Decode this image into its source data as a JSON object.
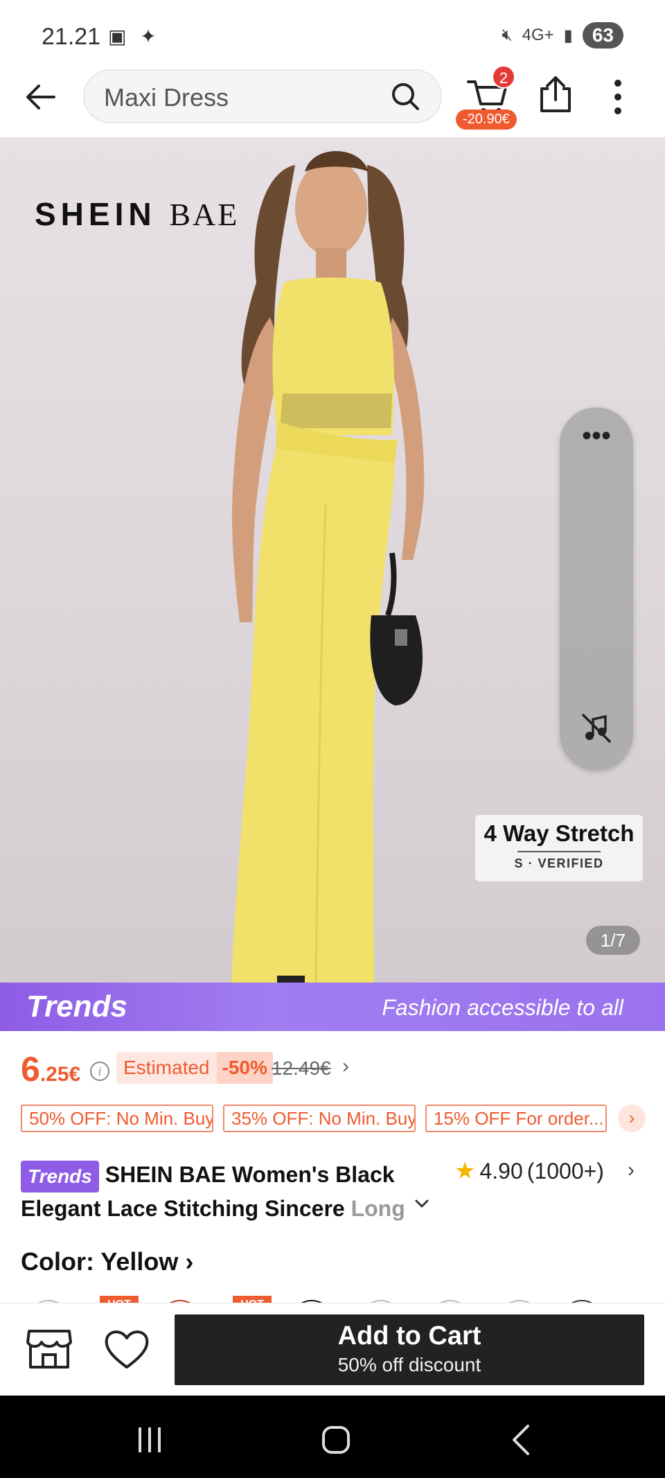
{
  "status_bar": {
    "time": "21.21",
    "network": "4G+",
    "battery": "63"
  },
  "nav": {
    "search_text": "Maxi Dress",
    "cart_count": "2",
    "cart_discount": "-20.90€"
  },
  "hero": {
    "brand": {
      "part1": "SHEIN",
      "part2": "BAE"
    },
    "stretch_title": "4 Way Stretch",
    "stretch_sub": "S · VERIFIED",
    "image_counter": "1/7"
  },
  "banner": {
    "logo": "Trends",
    "tagline": "Fashion accessible to all"
  },
  "price": {
    "integer": "6",
    "decimal": ".25€",
    "estimated_label": "Estimated",
    "discount_pct": "-50%",
    "original": "12.49€"
  },
  "coupons": [
    "50% OFF: No Min. Buy",
    "35% OFF: No Min. Buy",
    "15% OFF For order..."
  ],
  "product": {
    "trends_chip": "Trends",
    "title_main": "SHEIN BAE Women's Black Elegant Lace Stitching Sincere",
    "title_fade": "Long",
    "rating": "4.90",
    "rating_count": "(1000+)"
  },
  "color": {
    "label": "Color: Yellow ›",
    "hot_tag": "HOT"
  },
  "bottom": {
    "add_to_cart": "Add to Cart",
    "discount_text": "50% off discount"
  },
  "colors": {
    "accent": "#ef5a2f",
    "trends_purple": "#8e5ce6",
    "dress_yellow": "#f1e16a"
  }
}
